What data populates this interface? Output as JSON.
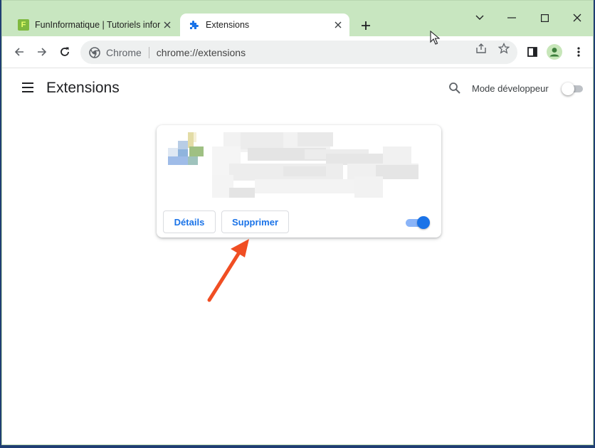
{
  "tabs": [
    {
      "title": "FunInformatique | Tutoriels informatique",
      "favicon_letter": "F",
      "active": false
    },
    {
      "title": "Extensions",
      "active": true
    }
  ],
  "toolbar": {
    "omnibox_site": "Chrome",
    "omnibox_url": "chrome://extensions"
  },
  "page": {
    "title": "Extensions",
    "dev_mode_label": "Mode développeur",
    "dev_mode_enabled": false
  },
  "extension_card": {
    "details_label": "Détails",
    "remove_label": "Supprimer",
    "enabled": true
  },
  "colors": {
    "tabstrip": "#c8e6c0",
    "accent": "#1a73e8",
    "annotation_arrow": "#f04e23"
  },
  "annotation": {
    "icon": "red-arrow-icon"
  }
}
